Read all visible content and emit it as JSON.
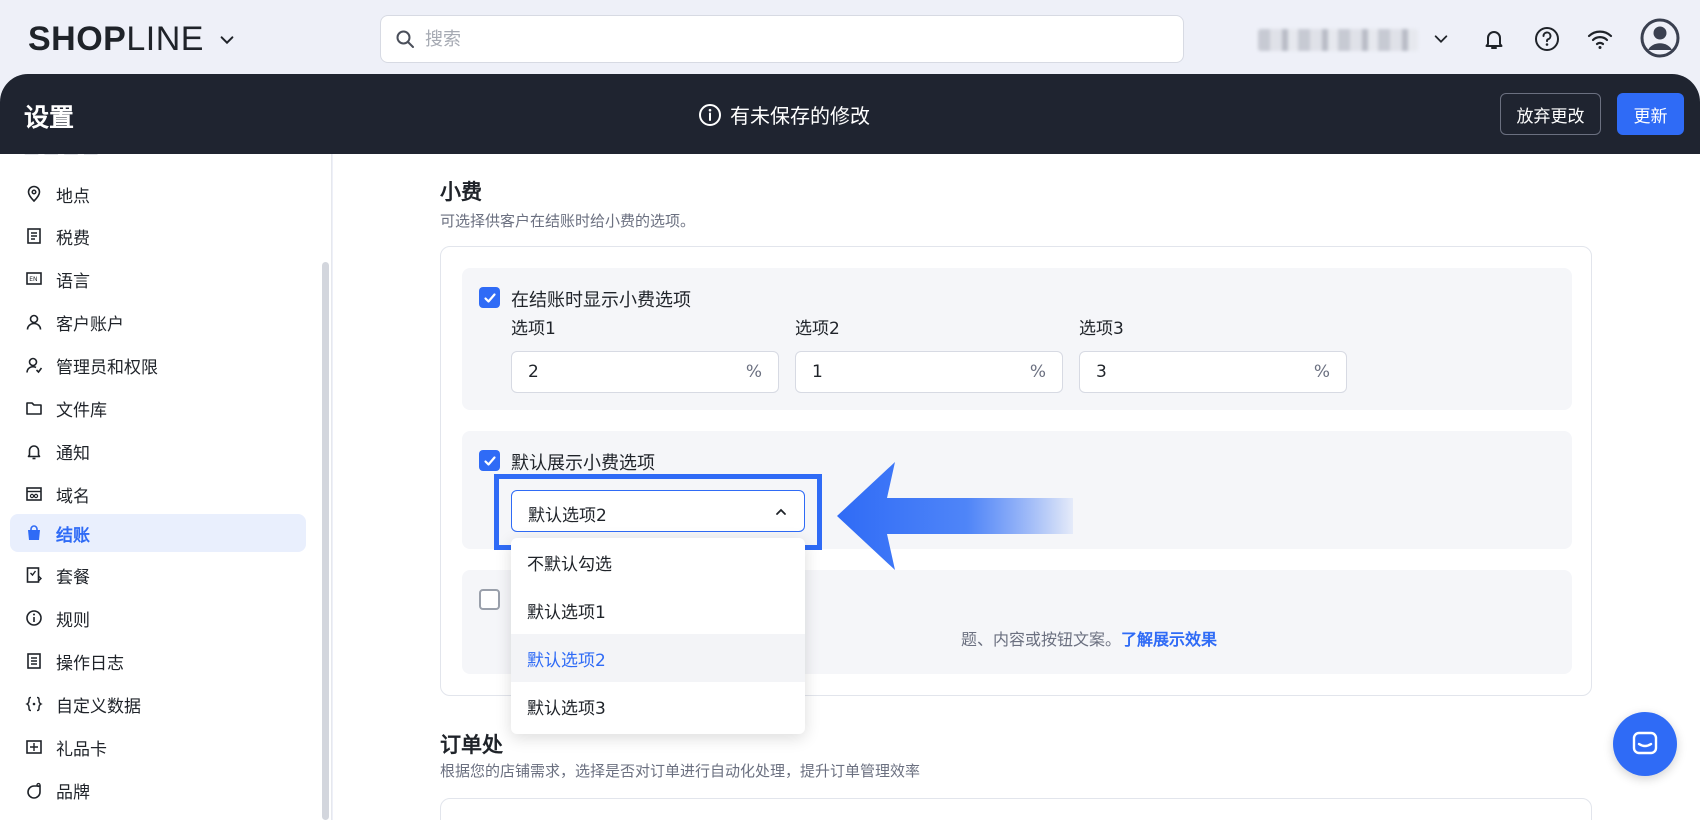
{
  "topbar": {
    "logo_bold": "SHOP",
    "logo_light": "LINE",
    "search_placeholder": "搜索"
  },
  "header": {
    "title": "设置",
    "unsaved": "有未保存的修改",
    "discard_label": "放弃更改",
    "update_label": "更新"
  },
  "sidebar": {
    "items": [
      {
        "label": "地点",
        "icon": "location-icon"
      },
      {
        "label": "税费",
        "icon": "tax-icon"
      },
      {
        "label": "语言",
        "icon": "language-icon"
      },
      {
        "label": "客户账户",
        "icon": "user-icon"
      },
      {
        "label": "管理员和权限",
        "icon": "admin-icon"
      },
      {
        "label": "文件库",
        "icon": "folder-icon"
      },
      {
        "label": "通知",
        "icon": "bell-icon"
      },
      {
        "label": "域名",
        "icon": "domain-icon"
      },
      {
        "label": "结账",
        "icon": "bag-icon",
        "active": true
      },
      {
        "label": "套餐",
        "icon": "plan-icon"
      },
      {
        "label": "规则",
        "icon": "info-icon"
      },
      {
        "label": "操作日志",
        "icon": "log-icon"
      },
      {
        "label": "自定义数据",
        "icon": "braces-icon"
      },
      {
        "label": "礼品卡",
        "icon": "gift-card-icon"
      },
      {
        "label": "品牌",
        "icon": "brand-icon"
      }
    ]
  },
  "tips": {
    "title": "小费",
    "desc": "可选择供客户在结账时给小费的选项。",
    "show_tips_label": "在结账时显示小费选项",
    "options": [
      {
        "label": "选项1",
        "value": "2",
        "unit": "%"
      },
      {
        "label": "选项2",
        "value": "1",
        "unit": "%"
      },
      {
        "label": "选项3",
        "value": "3",
        "unit": "%"
      }
    ],
    "default_label": "默认展示小费选项",
    "select_value": "默认选项2",
    "dropdown_options": [
      "不默认勾选",
      "默认选项1",
      "默认选项2",
      "默认选项3"
    ],
    "selected_index": 2,
    "third_text_visible": "题、内容或按钮文案。",
    "third_link": "了解展示效果"
  },
  "order": {
    "title_visible": "订单处",
    "desc": "根据您的店铺需求，选择是否对订单进行自动化处理，提升订单管理效率"
  },
  "colors": {
    "accent": "#2f6bf6",
    "dark_header": "#1f2430"
  }
}
